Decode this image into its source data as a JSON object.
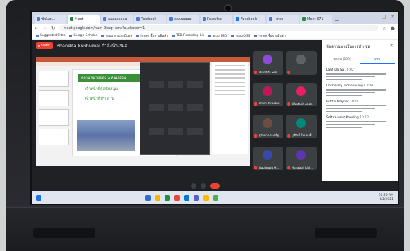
{
  "browser": {
    "tabs": [
      {
        "label": "ชั่วโมง...",
        "color": "#4a7bd0",
        "active": false
      },
      {
        "label": "Meet",
        "color": "#1e8e3e",
        "active": true
      },
      {
        "label": "aaaaaaaaa",
        "color": "#4a7bd0",
        "active": false
      },
      {
        "label": "Textbook",
        "color": "#4a7bd0",
        "active": false
      },
      {
        "label": "aaaaaaaa",
        "color": "#4a7bd0",
        "active": false
      },
      {
        "label": "Papalfsx",
        "color": "#4a7bd0",
        "active": false
      },
      {
        "label": "Facebook",
        "color": "#1877f2",
        "active": false
      },
      {
        "label": "i-mee",
        "color": "#4a7bd0",
        "active": false
      },
      {
        "label": "Meet 371",
        "color": "#1e8e3e",
        "active": false
      }
    ],
    "url": "meet.google.com/hum-9kuqr-pma?authuser=1",
    "bookmarks": [
      "Suggested Sites",
      "Google Scholar",
      "ระบบการประเมินผล",
      "i-mee ซื้อขายสินค้า",
      "TEB Recording Lis",
      "ระบบ SSO",
      "ระบบ OSS",
      "i-mee ซื้อขายสินค้า"
    ]
  },
  "meet": {
    "rec_label": "บันทึก",
    "presenter": "Phandita Sukhumal กำลังนำเสนอ",
    "slide": {
      "title": "ความหมายของ ๖ คุณธรรม",
      "lines": [
        "เจ้าหน้าที่ผู้สนับสนุน",
        "เจ้าหน้าที่ประสาน"
      ]
    },
    "participants": [
      {
        "name": "Phandita Suk...",
        "color": "#8e4bd6"
      },
      {
        "name": "",
        "color": "#5f6368"
      },
      {
        "name": "ศรีสุดา จีนพงษ์ผม",
        "color": "#c2185b"
      },
      {
        "name": "Wantanit Anon",
        "color": "#e91e63"
      },
      {
        "name": "สุนันทา ประเสริฐ",
        "color": "#6d4c41"
      },
      {
        "name": "บุริรัตน์ ใหมอนที่",
        "color": "#00897b"
      },
      {
        "name": "Wachiravit H...",
        "color": "#3949ab"
      },
      {
        "name": "Hanabuli Ichi...",
        "color": "#5e35b1"
      }
    ],
    "panel": {
      "title": "ข้อความภายในการประชุม",
      "tabs": [
        "ทุกคน (199)",
        "แชท"
      ],
      "messages": [
        {
          "name": "Laat Kla Su",
          "time": "10:02"
        },
        {
          "name": "Ultimately pronouncing",
          "time": "10:08"
        },
        {
          "name": "Ruthai Mayriat",
          "time": "10:11"
        },
        {
          "name": "Seltirasunut Konding",
          "time": "10:12"
        }
      ]
    }
  },
  "taskbar": {
    "time": "10:26 AM",
    "date": "8/2/2021",
    "icons": [
      "#2d6cdf",
      "#f5b300",
      "#1e8e3e",
      "#e8453c",
      "#0078d4",
      "#5b5fc7",
      "#ffb900",
      "#4caf50"
    ]
  }
}
